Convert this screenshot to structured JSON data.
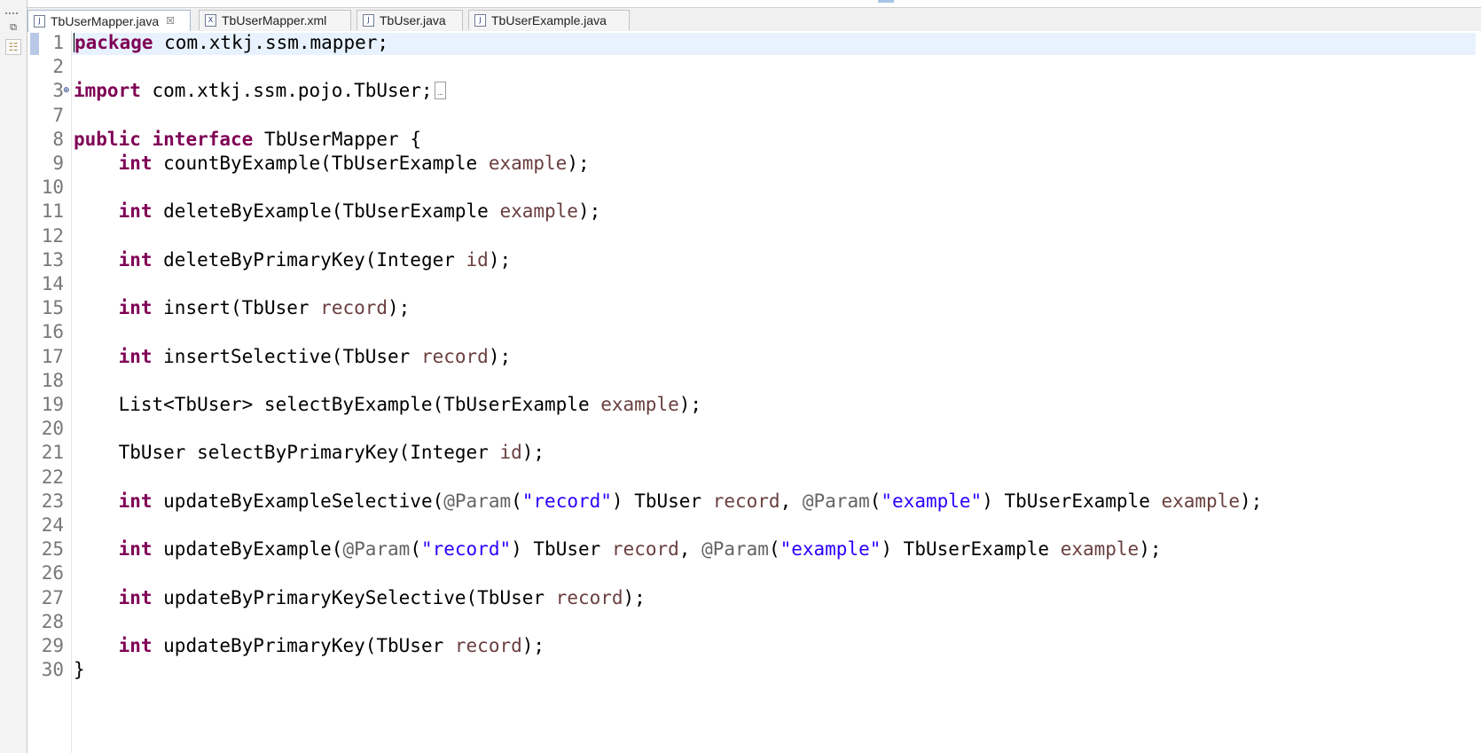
{
  "tabs": [
    {
      "label": "TbUserMapper.java",
      "icon": "java-file-icon",
      "active": true
    },
    {
      "label": "TbUserMapper.xml",
      "icon": "xml-file-icon",
      "active": false
    },
    {
      "label": "TbUser.java",
      "icon": "java-file-icon",
      "active": false
    },
    {
      "label": "TbUserExample.java",
      "icon": "java-file-icon",
      "active": false
    }
  ],
  "editor": {
    "lines": [
      {
        "n": "1",
        "tokens": [
          [
            "kw",
            "package"
          ],
          [
            "t",
            " com.xtkj.ssm.mapper;"
          ]
        ]
      },
      {
        "n": "2",
        "tokens": []
      },
      {
        "n": "3",
        "fold": true,
        "tokens": [
          [
            "kw",
            "import"
          ],
          [
            "t",
            " com.xtkj.ssm.pojo.TbUser;"
          ]
        ],
        "collapsed": true
      },
      {
        "n": "7",
        "tokens": []
      },
      {
        "n": "8",
        "tokens": [
          [
            "kw",
            "public"
          ],
          [
            "t",
            " "
          ],
          [
            "kw",
            "interface"
          ],
          [
            "t",
            " TbUserMapper {"
          ]
        ]
      },
      {
        "n": "9",
        "tokens": [
          [
            "t",
            "    "
          ],
          [
            "kw",
            "int"
          ],
          [
            "t",
            " countByExample(TbUserExample "
          ],
          [
            "param",
            "example"
          ],
          [
            "t",
            ");"
          ]
        ]
      },
      {
        "n": "10",
        "tokens": []
      },
      {
        "n": "11",
        "tokens": [
          [
            "t",
            "    "
          ],
          [
            "kw",
            "int"
          ],
          [
            "t",
            " deleteByExample(TbUserExample "
          ],
          [
            "param",
            "example"
          ],
          [
            "t",
            ");"
          ]
        ]
      },
      {
        "n": "12",
        "tokens": []
      },
      {
        "n": "13",
        "tokens": [
          [
            "t",
            "    "
          ],
          [
            "kw",
            "int"
          ],
          [
            "t",
            " deleteByPrimaryKey(Integer "
          ],
          [
            "param",
            "id"
          ],
          [
            "t",
            ");"
          ]
        ]
      },
      {
        "n": "14",
        "tokens": []
      },
      {
        "n": "15",
        "tokens": [
          [
            "t",
            "    "
          ],
          [
            "kw",
            "int"
          ],
          [
            "t",
            " insert(TbUser "
          ],
          [
            "param",
            "record"
          ],
          [
            "t",
            ");"
          ]
        ]
      },
      {
        "n": "16",
        "tokens": []
      },
      {
        "n": "17",
        "tokens": [
          [
            "t",
            "    "
          ],
          [
            "kw",
            "int"
          ],
          [
            "t",
            " insertSelective(TbUser "
          ],
          [
            "param",
            "record"
          ],
          [
            "t",
            ");"
          ]
        ]
      },
      {
        "n": "18",
        "tokens": []
      },
      {
        "n": "19",
        "tokens": [
          [
            "t",
            "    List<TbUser> selectByExample(TbUserExample "
          ],
          [
            "param",
            "example"
          ],
          [
            "t",
            ");"
          ]
        ]
      },
      {
        "n": "20",
        "tokens": []
      },
      {
        "n": "21",
        "tokens": [
          [
            "t",
            "    TbUser selectByPrimaryKey(Integer "
          ],
          [
            "param",
            "id"
          ],
          [
            "t",
            ");"
          ]
        ]
      },
      {
        "n": "22",
        "tokens": []
      },
      {
        "n": "23",
        "tokens": [
          [
            "t",
            "    "
          ],
          [
            "kw",
            "int"
          ],
          [
            "t",
            " updateByExampleSelective("
          ],
          [
            "ann",
            "@Param"
          ],
          [
            "t",
            "("
          ],
          [
            "str",
            "\"record\""
          ],
          [
            "t",
            ") TbUser "
          ],
          [
            "param",
            "record"
          ],
          [
            "t",
            ", "
          ],
          [
            "ann",
            "@Param"
          ],
          [
            "t",
            "("
          ],
          [
            "str",
            "\"example\""
          ],
          [
            "t",
            ") TbUserExample "
          ],
          [
            "param",
            "example"
          ],
          [
            "t",
            ");"
          ]
        ]
      },
      {
        "n": "24",
        "tokens": []
      },
      {
        "n": "25",
        "tokens": [
          [
            "t",
            "    "
          ],
          [
            "kw",
            "int"
          ],
          [
            "t",
            " updateByExample("
          ],
          [
            "ann",
            "@Param"
          ],
          [
            "t",
            "("
          ],
          [
            "str",
            "\"record\""
          ],
          [
            "t",
            ") TbUser "
          ],
          [
            "param",
            "record"
          ],
          [
            "t",
            ", "
          ],
          [
            "ann",
            "@Param"
          ],
          [
            "t",
            "("
          ],
          [
            "str",
            "\"example\""
          ],
          [
            "t",
            ") TbUserExample "
          ],
          [
            "param",
            "example"
          ],
          [
            "t",
            ");"
          ]
        ]
      },
      {
        "n": "26",
        "tokens": []
      },
      {
        "n": "27",
        "tokens": [
          [
            "t",
            "    "
          ],
          [
            "kw",
            "int"
          ],
          [
            "t",
            " updateByPrimaryKeySelective(TbUser "
          ],
          [
            "param",
            "record"
          ],
          [
            "t",
            ");"
          ]
        ]
      },
      {
        "n": "28",
        "tokens": []
      },
      {
        "n": "29",
        "tokens": [
          [
            "t",
            "    "
          ],
          [
            "kw",
            "int"
          ],
          [
            "t",
            " updateByPrimaryKey(TbUser "
          ],
          [
            "param",
            "record"
          ],
          [
            "t",
            ");"
          ]
        ]
      },
      {
        "n": "30",
        "tokens": [
          [
            "t",
            "}"
          ]
        ]
      }
    ]
  },
  "colors": {
    "keyword": "#7f0055",
    "parameter": "#6a3e3e",
    "string": "#2a00ff",
    "annotation": "#646464",
    "current_line": "#e8f2fe"
  }
}
